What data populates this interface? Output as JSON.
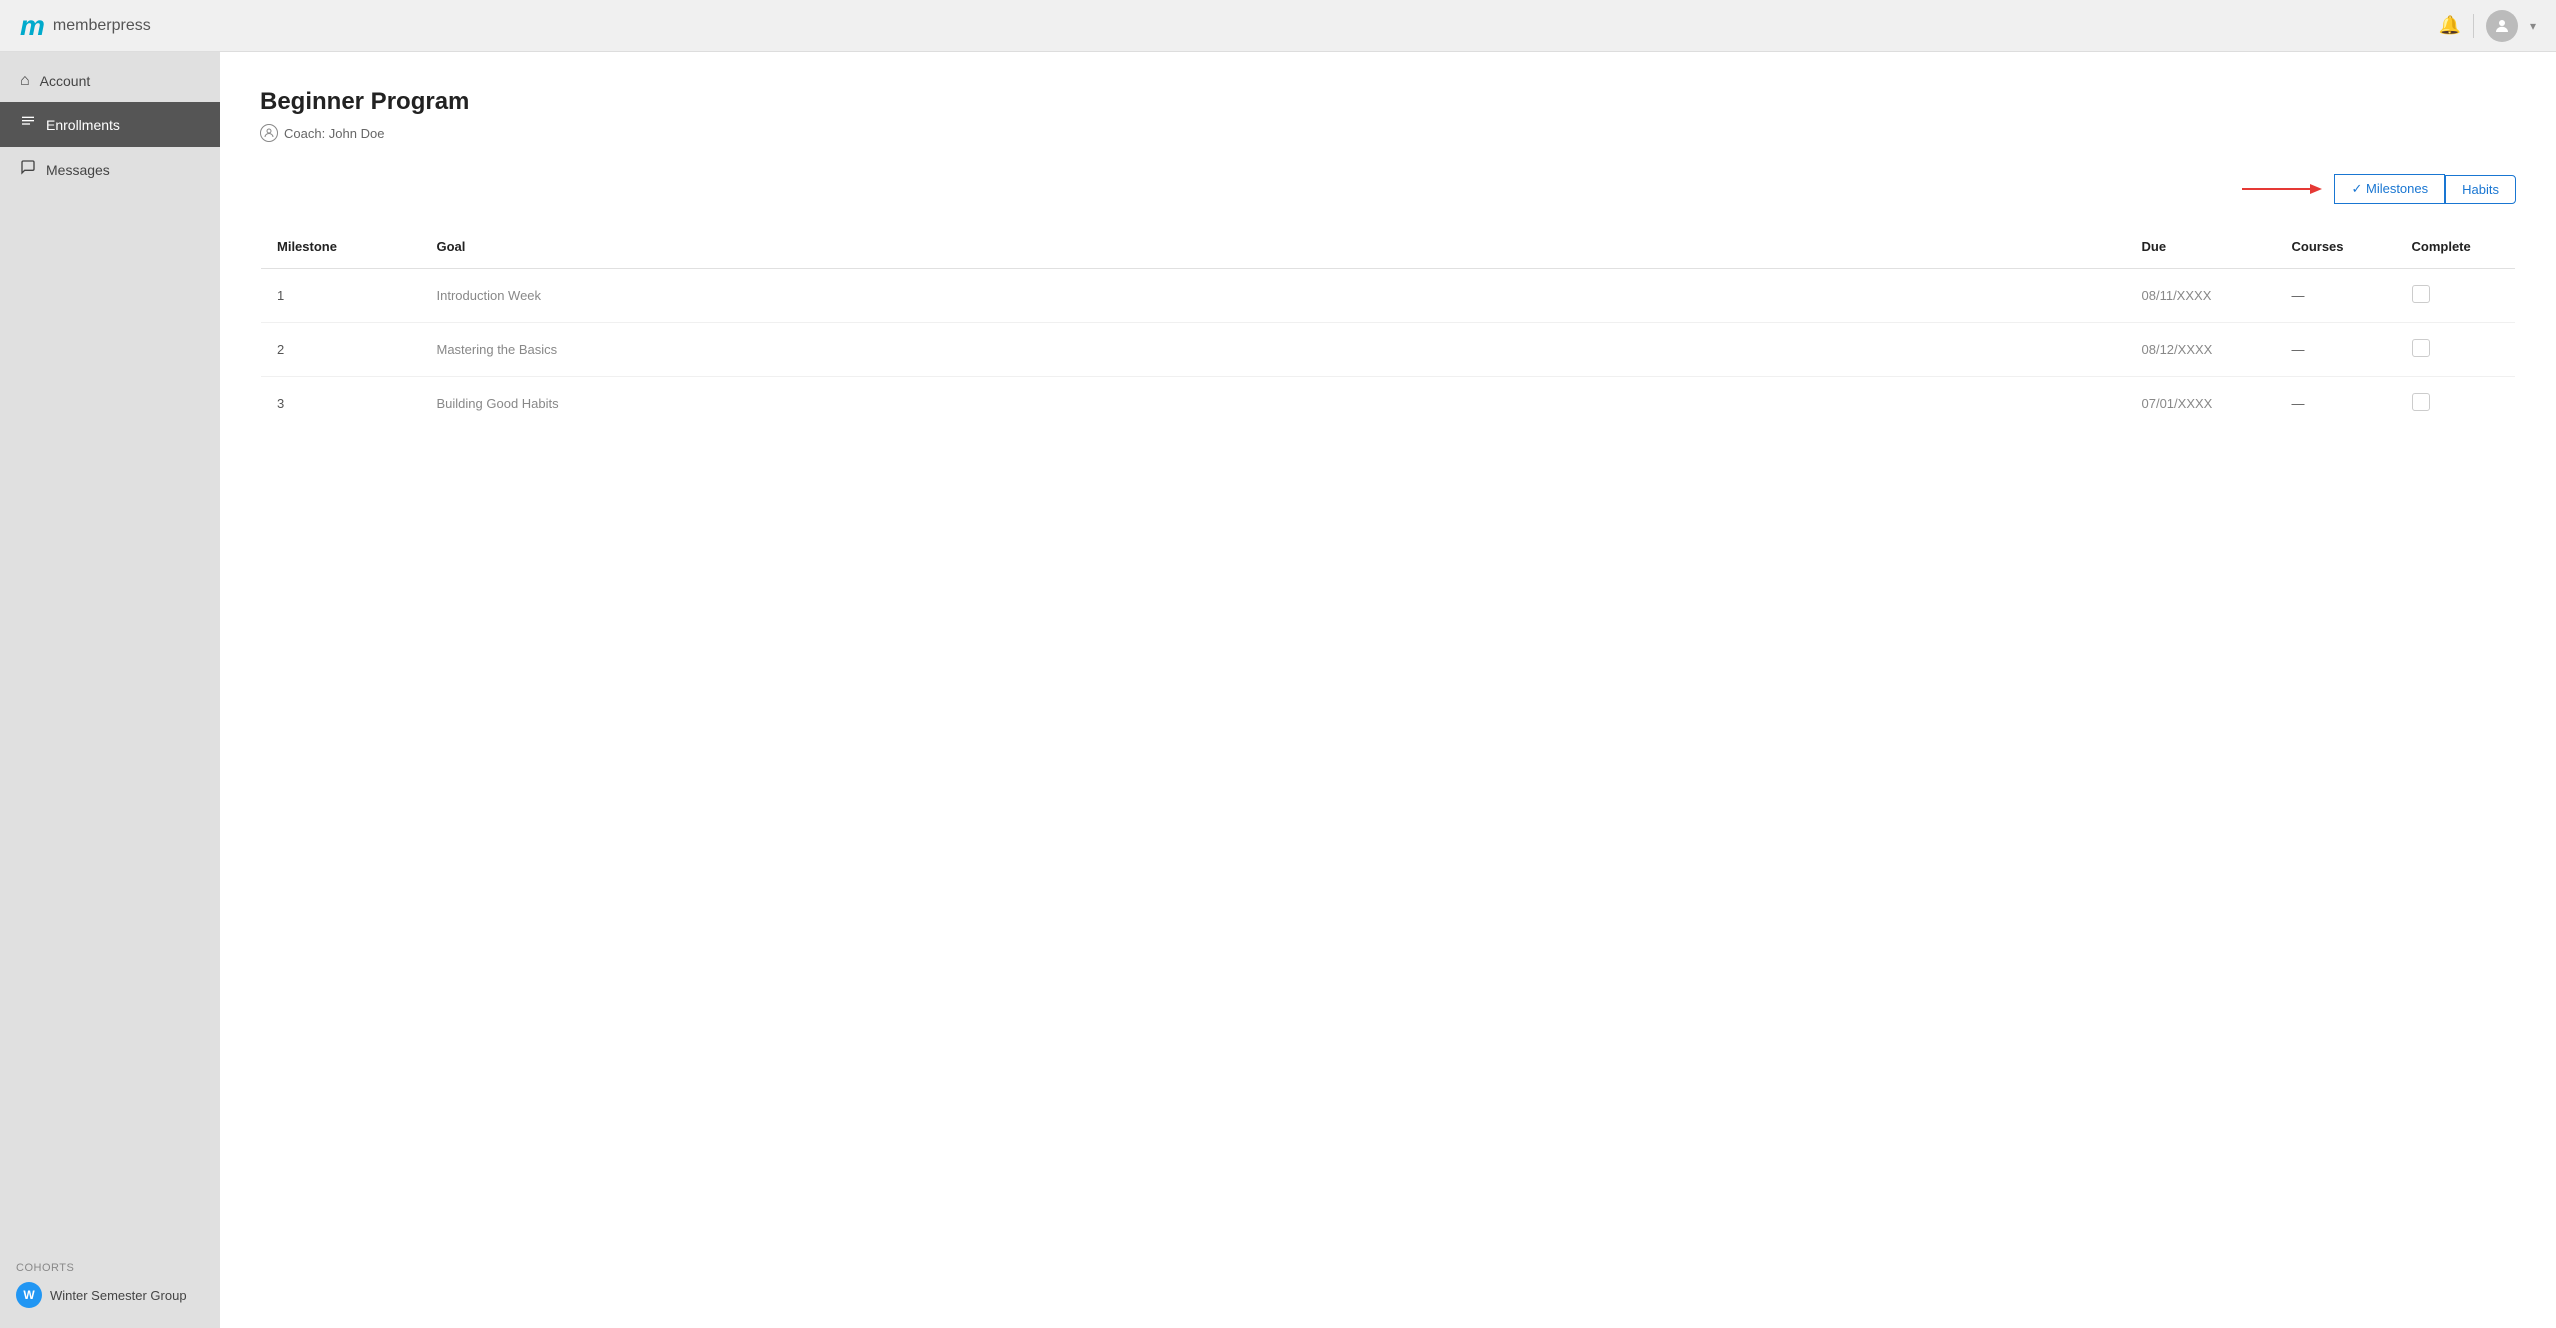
{
  "header": {
    "logo_m": "m",
    "logo_text": "memberpress",
    "bell_icon": "🔔"
  },
  "sidebar": {
    "items": [
      {
        "id": "account",
        "label": "Account",
        "icon": "⌂",
        "active": false
      },
      {
        "id": "enrollments",
        "label": "Enrollments",
        "icon": "☰",
        "active": true
      },
      {
        "id": "messages",
        "label": "Messages",
        "icon": "💬",
        "active": false
      }
    ],
    "cohorts_label": "Cohorts",
    "cohort": {
      "initial": "W",
      "name": "Winter Semester Group"
    }
  },
  "main": {
    "page_title": "Beginner Program",
    "coach_label": "Coach: John Doe",
    "toggle": {
      "milestones_label": "✓ Milestones",
      "habits_label": "Habits"
    },
    "table": {
      "columns": [
        "Milestone",
        "Goal",
        "Due",
        "Courses",
        "Complete"
      ],
      "rows": [
        {
          "milestone": "1",
          "goal": "Introduction Week",
          "due": "08/11/XXXX",
          "courses": "—",
          "complete": ""
        },
        {
          "milestone": "2",
          "goal": "Mastering the Basics",
          "due": "08/12/XXXX",
          "courses": "—",
          "complete": ""
        },
        {
          "milestone": "3",
          "goal": "Building Good Habits",
          "due": "07/01/XXXX",
          "courses": "—",
          "complete": ""
        }
      ]
    }
  }
}
